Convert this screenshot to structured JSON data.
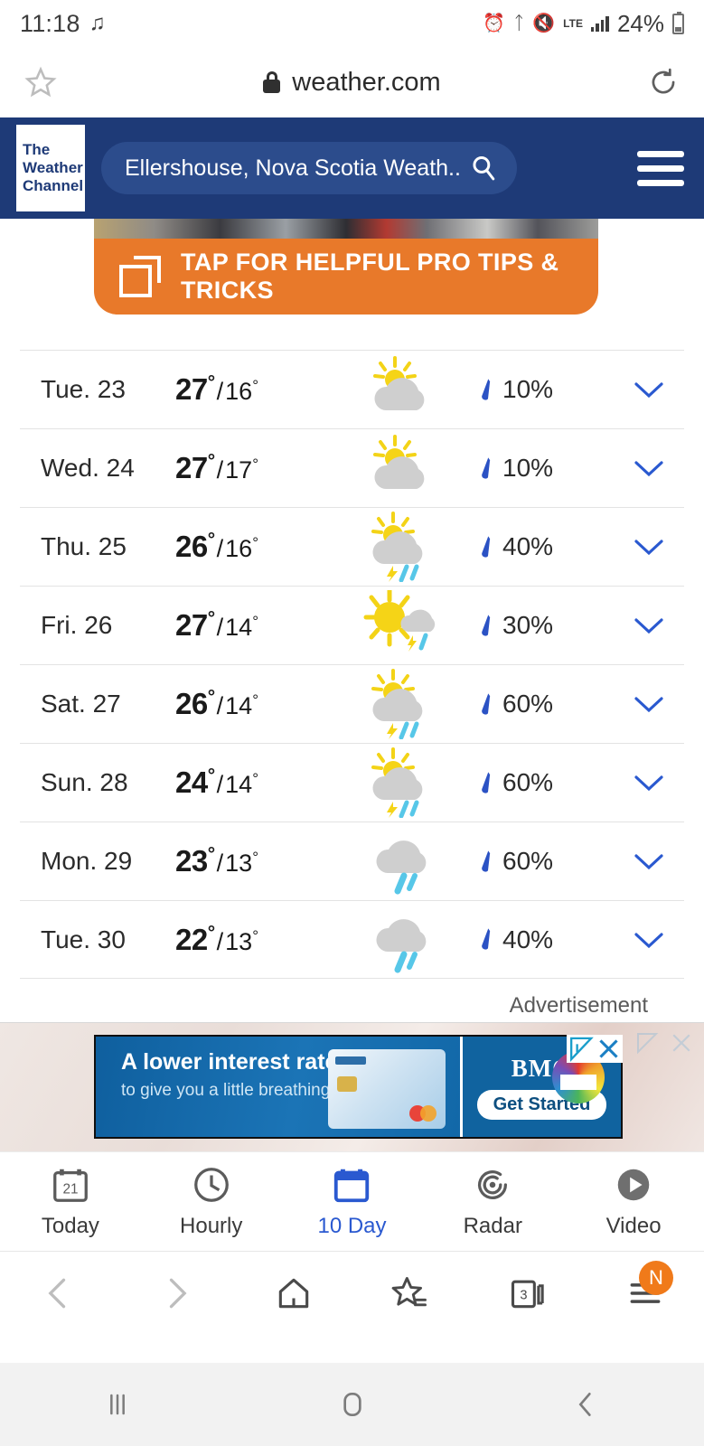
{
  "status_bar": {
    "time": "11:18",
    "music_icon": "music-note-icon",
    "alarm_icon": "alarm-icon",
    "bluetooth_icon": "bluetooth-icon",
    "mute_icon": "mute-icon",
    "network_label": "LTE",
    "battery_percent": "24%"
  },
  "browser": {
    "url": "weather.com",
    "lock_icon": "lock-icon",
    "bookmark_icon": "star-icon",
    "reload_icon": "reload-icon",
    "toolbar": {
      "back": "back-chevron",
      "forward": "forward-chevron",
      "home": "home-icon",
      "bookmarks": "bookmarks-star-icon",
      "tabs_count": "3",
      "menu_badge": "N"
    }
  },
  "site_header": {
    "logo_line1": "The",
    "logo_line2": "Weather",
    "logo_line3": "Channel",
    "search_value": "Ellershouse, Nova Scotia Weath...",
    "search_icon": "search-icon",
    "menu_icon": "hamburger-icon",
    "accent_color": "#1e3a77"
  },
  "promo": {
    "text": "TAP FOR HELPFUL PRO TIPS & TRICKS",
    "icon": "layered-squares-icon",
    "color": "#e8792a"
  },
  "forecast": {
    "rows": [
      {
        "day": "Tue. 23",
        "high": "27",
        "low": "16",
        "precip": "10%",
        "condition": "partly-cloudy",
        "chevron": "chevron-down-icon"
      },
      {
        "day": "Wed. 24",
        "high": "27",
        "low": "17",
        "precip": "10%",
        "condition": "partly-cloudy",
        "chevron": "chevron-down-icon"
      },
      {
        "day": "Thu. 25",
        "high": "26",
        "low": "16",
        "precip": "40%",
        "condition": "sun-cloud-thunder-rain",
        "chevron": "chevron-down-icon"
      },
      {
        "day": "Fri. 26",
        "high": "27",
        "low": "14",
        "precip": "30%",
        "condition": "sunny-thunder-rain",
        "chevron": "chevron-down-icon"
      },
      {
        "day": "Sat. 27",
        "high": "26",
        "low": "14",
        "precip": "60%",
        "condition": "sun-cloud-thunder-rain",
        "chevron": "chevron-down-icon"
      },
      {
        "day": "Sun. 28",
        "high": "24",
        "low": "14",
        "precip": "60%",
        "condition": "sun-cloud-thunder-rain",
        "chevron": "chevron-down-icon"
      },
      {
        "day": "Mon. 29",
        "high": "23",
        "low": "13",
        "precip": "60%",
        "condition": "cloud-rain",
        "chevron": "chevron-down-icon"
      },
      {
        "day": "Tue. 30",
        "high": "22",
        "low": "13",
        "precip": "40%",
        "condition": "cloud-rain",
        "chevron": "chevron-down-icon"
      }
    ],
    "degree_symbol": "°",
    "separator": "/",
    "precip_icon": "raindrop-icon"
  },
  "advertisement": {
    "label": "Advertisement",
    "headline": "A lower interest rate",
    "subline": "to give you a little breathing room.",
    "brand": "BMO",
    "cta": "Get Started",
    "adchoices_icon": "adchoices-icon",
    "close_icon": "close-icon"
  },
  "app_tabs": [
    {
      "label": "Today",
      "icon": "calendar-21-icon",
      "active": false
    },
    {
      "label": "Hourly",
      "icon": "clock-icon",
      "active": false
    },
    {
      "label": "10 Day",
      "icon": "calendar-icon",
      "active": true
    },
    {
      "label": "Radar",
      "icon": "radar-icon",
      "active": false
    },
    {
      "label": "Video",
      "icon": "play-circle-icon",
      "active": false
    }
  ],
  "android_nav": {
    "recents": "recents-icon",
    "home": "home-square-icon",
    "back": "back-icon"
  }
}
